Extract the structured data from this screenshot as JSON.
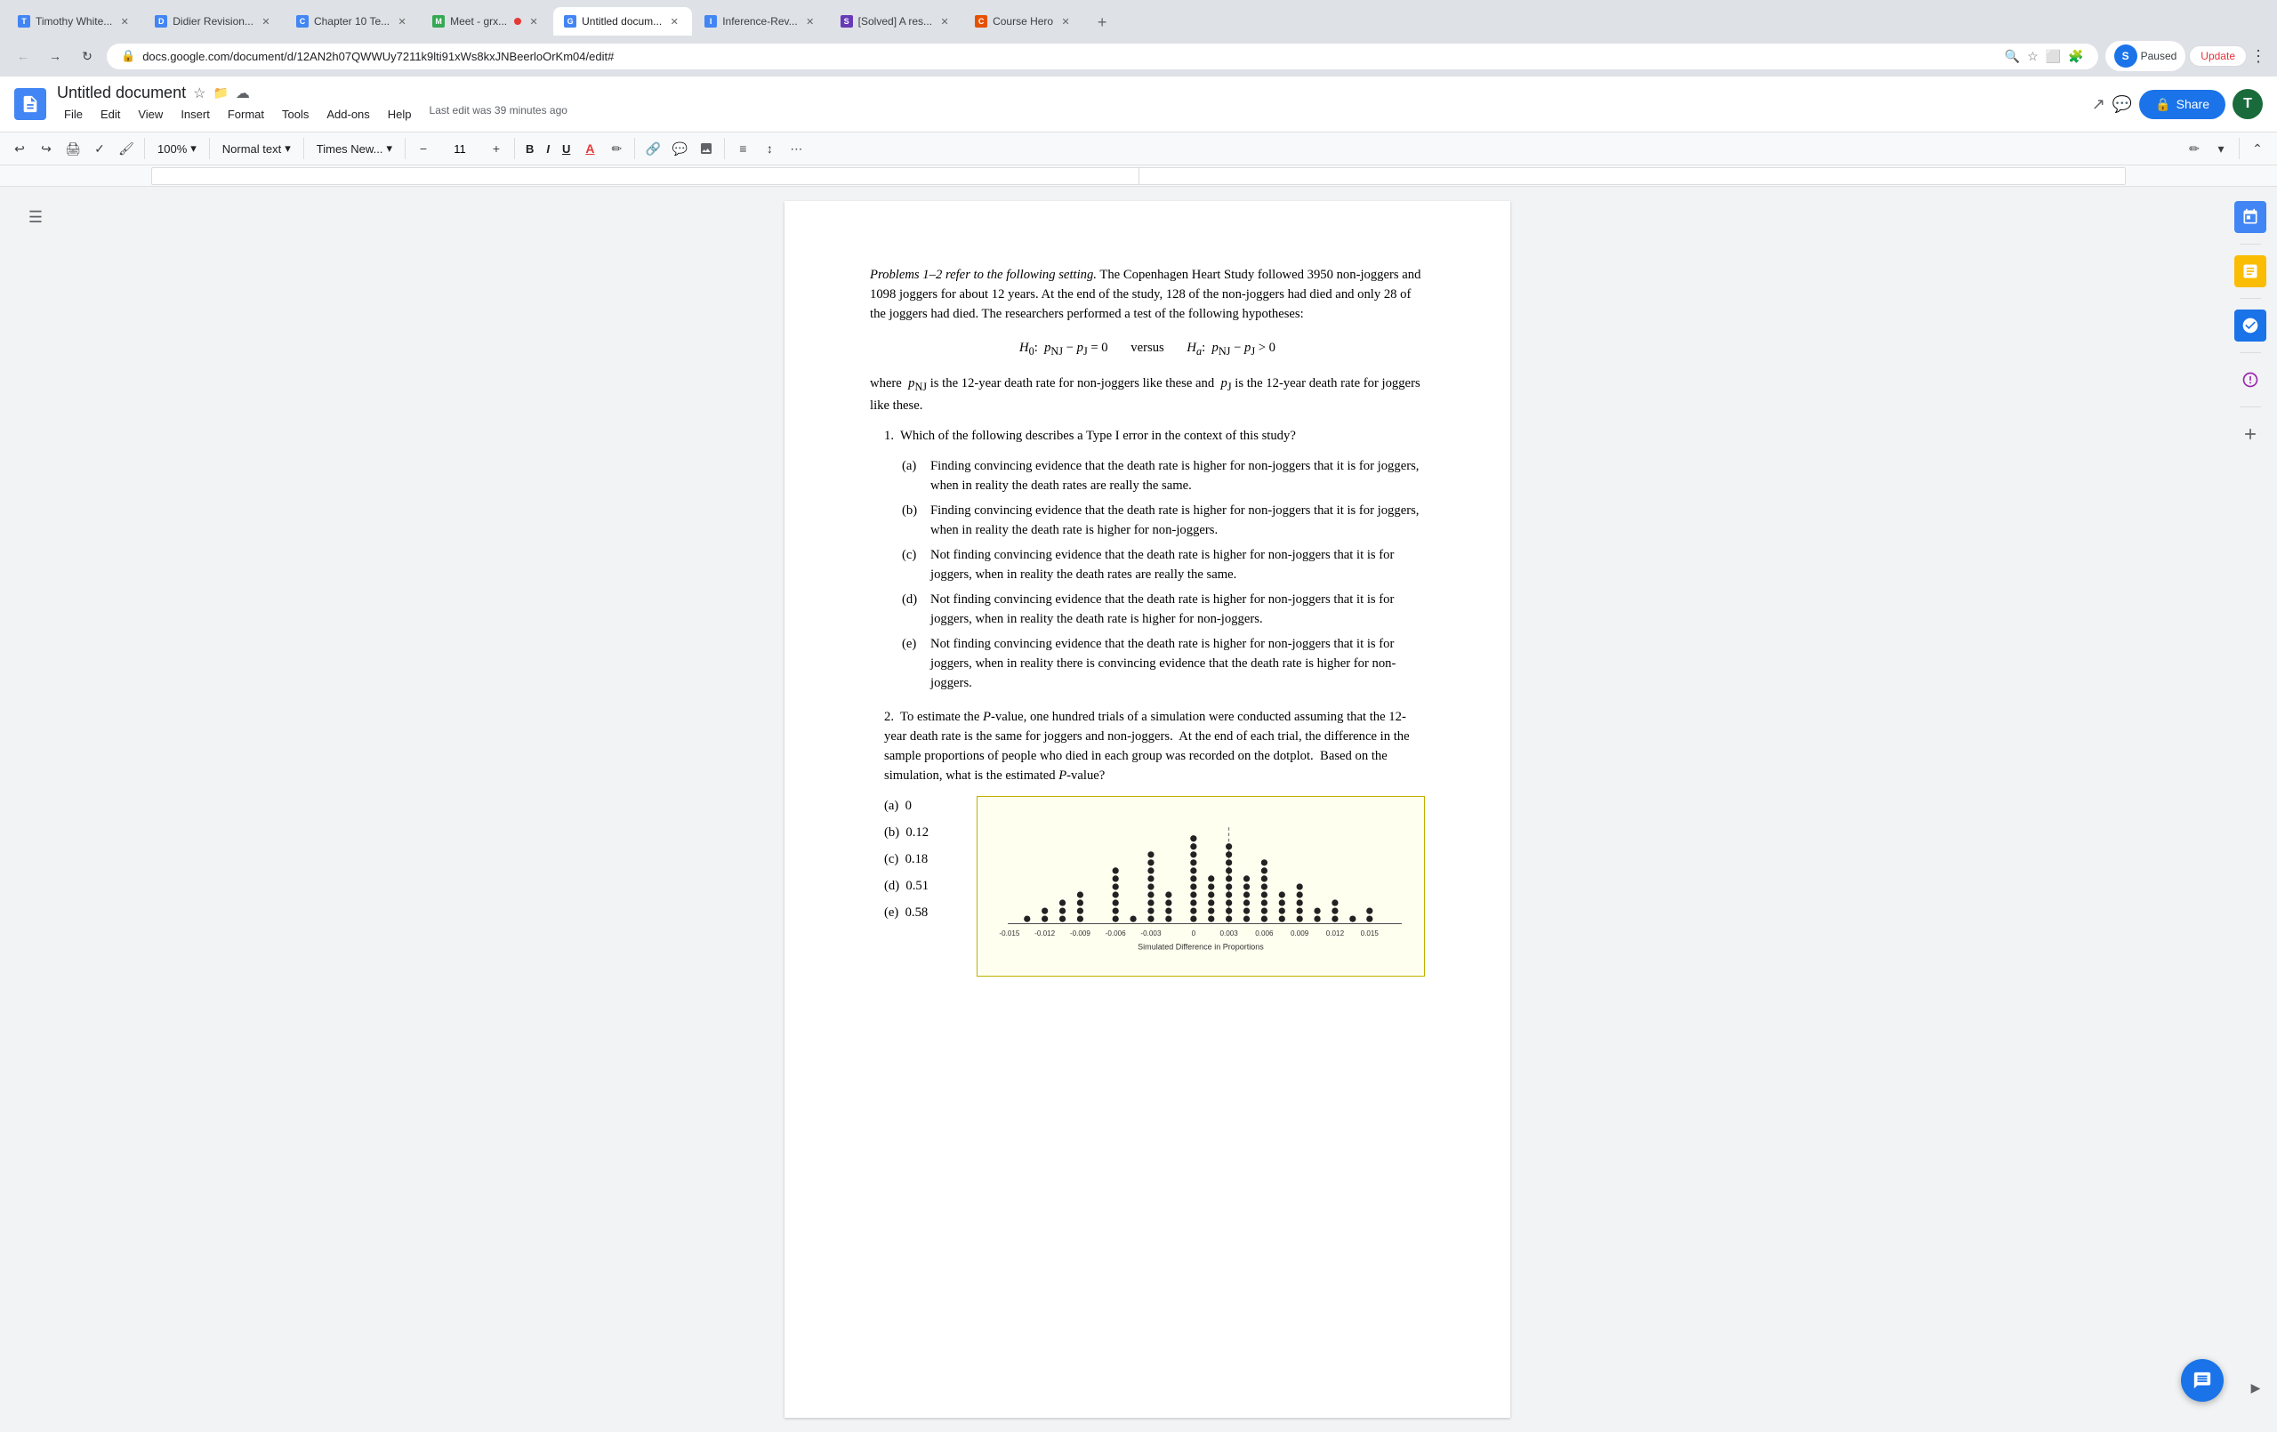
{
  "browser": {
    "tabs": [
      {
        "id": "tab1",
        "favicon_color": "#4285f4",
        "favicon_letter": "T",
        "title": "Timothy White...",
        "active": false
      },
      {
        "id": "tab2",
        "favicon_color": "#4285f4",
        "favicon_letter": "D",
        "title": "Didier Revision...",
        "active": false
      },
      {
        "id": "tab3",
        "favicon_color": "#4285f4",
        "favicon_letter": "C",
        "title": "Chapter 10 Te...",
        "active": false
      },
      {
        "id": "tab4",
        "favicon_color": "#34a853",
        "favicon_letter": "M",
        "title": "Meet - grx...",
        "active": false,
        "recording": true
      },
      {
        "id": "tab5",
        "favicon_color": "#4285f4",
        "favicon_letter": "G",
        "title": "Untitled docum...",
        "active": true
      },
      {
        "id": "tab6",
        "favicon_color": "#4285f4",
        "favicon_letter": "I",
        "title": "Inference-Rev...",
        "active": false
      },
      {
        "id": "tab7",
        "favicon_color": "#673ab7",
        "favicon_letter": "S",
        "title": "[Solved] A res...",
        "active": false
      },
      {
        "id": "tab8",
        "favicon_color": "#e65100",
        "favicon_letter": "C",
        "title": "Course Hero",
        "active": false
      }
    ],
    "new_tab_label": "+",
    "address": "docs.google.com/document/d/12AN2h07QWWUy7211k9lti91xWs8kxJNBeerloOrKm04/edit#",
    "nav": {
      "back_label": "←",
      "forward_label": "→",
      "reload_label": "↻"
    },
    "actions": {
      "bookmark_icon": "☆",
      "profile_icon": "S",
      "profile_color": "#1a73e8",
      "paused_label": "Paused",
      "update_label": "Update"
    }
  },
  "docs": {
    "logo_letter": "≡",
    "title": "Untitled document",
    "star_icon": "☆",
    "folder_icon": "⬜",
    "cloud_icon": "☁",
    "menu_items": [
      "File",
      "Edit",
      "View",
      "Insert",
      "Format",
      "Tools",
      "Add-ons",
      "Help"
    ],
    "last_edit": "Last edit was 39 minutes ago",
    "header_actions": {
      "trend_icon": "↗",
      "comment_icon": "💬",
      "share_label": "Share",
      "lock_icon": "🔒",
      "profile_letter": "T",
      "profile_color": "#1a6b3c"
    },
    "toolbar": {
      "undo_icon": "↩",
      "redo_icon": "↪",
      "print_icon": "🖶",
      "spell_icon": "✓",
      "paint_icon": "🖌",
      "zoom_value": "100%",
      "style_label": "Normal text",
      "style_arrow": "▾",
      "font_label": "Times New...",
      "font_arrow": "▾",
      "font_size_minus": "−",
      "font_size_value": "11",
      "font_size_plus": "+",
      "bold_label": "B",
      "italic_label": "I",
      "underline_label": "U",
      "font_color_icon": "A",
      "highlight_icon": "✏",
      "link_icon": "🔗",
      "comment_icon": "💬",
      "image_icon": "🖼",
      "align_icon": "≡",
      "line_spacing_icon": "↕",
      "more_icon": "⋯",
      "pen_icon": "✏",
      "chevron_up": "⌃",
      "chevron_down": "⌄"
    }
  },
  "document": {
    "intro_paragraph": "Problems 1–2 refer to the following setting.  The Copenhagen Heart Study followed 3950 non-joggers and 1098 joggers for about 12 years.  At the end of the study, 128 of the non-joggers had died and only 28 of the joggers had died.  The researchers performed a test of the following hypotheses:",
    "hypothesis": {
      "h0_label": "H",
      "h0_sub": "0",
      "h0_text": ":  p",
      "h0_nj": "NJ",
      "h0_minus": " − p",
      "h0_j": "J",
      "h0_eq": " = 0",
      "versus": "versus",
      "ha_label": "H",
      "ha_sub": "a",
      "ha_text": ":  p",
      "ha_nj": "NJ",
      "ha_minus": " − p",
      "ha_j": "J",
      "ha_gt": " > 0"
    },
    "where_text": "where  p",
    "where_nj": "NJ",
    "where_mid": " is the 12-year death rate for non-joggers like these and  p",
    "where_j": "J",
    "where_end": " is the 12-year death rate for joggers like these.",
    "q1": {
      "number": "1.",
      "text": "Which of the following describes a Type I error in the context of this study?",
      "options": [
        {
          "label": "(a)",
          "text": "Finding convincing evidence that the death rate is higher for non-joggers that it is for joggers, when in reality the death rates are really the same."
        },
        {
          "label": "(b)",
          "text": "Finding convincing evidence that the death rate is higher for non-joggers that it is for joggers, when in reality the death rate is higher for non-joggers."
        },
        {
          "label": "(c)",
          "text": "Not finding convincing evidence that the death rate is higher for non-joggers that it is for joggers, when in reality the death rates are really the same."
        },
        {
          "label": "(d)",
          "text": "Not finding convincing evidence that the death rate is higher for non-joggers that it is for joggers, when in reality the death rate is higher for non-joggers."
        },
        {
          "label": "(e)",
          "text": "Not finding convincing evidence that the death rate is higher for non-joggers that it is for joggers, when in reality there is convincing evidence that the death rate is higher for non-joggers."
        }
      ]
    },
    "q2": {
      "number": "2.",
      "text": "To estimate the P-value, one hundred trials of a simulation were conducted assuming that the 12-year death rate is the same for joggers and non-joggers.  At the end of each trial, the difference in the sample proportions of people who died in each group was recorded on the dotplot.  Based on the simulation, what is the estimated P-value?",
      "options": [
        {
          "label": "(a)",
          "text": "0"
        },
        {
          "label": "(b)",
          "text": "0.12"
        },
        {
          "label": "(c)",
          "text": "0.18"
        },
        {
          "label": "(d)",
          "text": "0.51"
        },
        {
          "label": "(e)",
          "text": "0.58"
        }
      ],
      "dotplot": {
        "x_label": "Simulated Difference in Proportions",
        "x_axis": [
          "-0.015",
          "-0.012",
          "-0.009",
          "-0.006",
          "-0.003",
          "0",
          "0.003",
          "0.006",
          "0.009",
          "0.012",
          "0.015"
        ]
      }
    }
  },
  "right_panel": {
    "icons": [
      "📅",
      "🗒",
      "✔",
      "🐴",
      "+"
    ]
  }
}
